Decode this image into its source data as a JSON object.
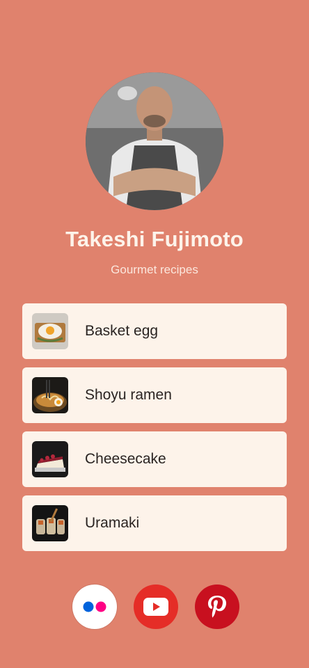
{
  "profile": {
    "name": "Takeshi Fujimoto",
    "subtitle": "Gourmet recipes",
    "avatar_icon": "chef-portrait"
  },
  "links": [
    {
      "label": "Basket egg",
      "thumb_icon": "basket-egg-photo"
    },
    {
      "label": "Shoyu ramen",
      "thumb_icon": "ramen-photo"
    },
    {
      "label": "Cheesecake",
      "thumb_icon": "cheesecake-photo"
    },
    {
      "label": "Uramaki",
      "thumb_icon": "uramaki-photo"
    }
  ],
  "socials": [
    {
      "name": "Flickr",
      "icon": "flickr-icon",
      "color": "#ffffff"
    },
    {
      "name": "YouTube",
      "icon": "youtube-icon",
      "color": "#e52d27"
    },
    {
      "name": "Pinterest",
      "icon": "pinterest-icon",
      "color": "#c8101f"
    }
  ],
  "colors": {
    "background": "#e0826d",
    "card": "#fdf3ea",
    "text_dark": "#2a2422",
    "text_light": "#fdf3ea"
  }
}
